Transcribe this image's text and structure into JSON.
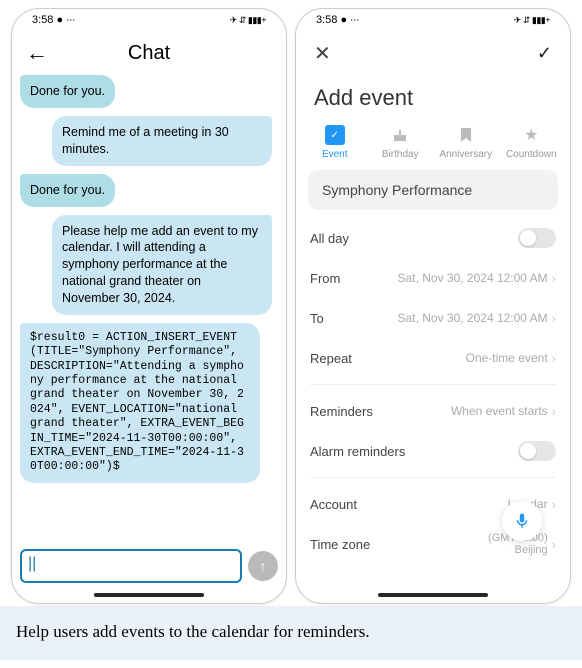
{
  "status": {
    "time": "3:58",
    "dots": "● ∙∙∙",
    "icons": "✈ ⇵ ▮▮▮+"
  },
  "chat": {
    "back": "←",
    "title": "Chat",
    "msgs": {
      "m1": "Done for you.",
      "m2": "Remind me of a meeting in 30 minutes.",
      "m3": "Done for you.",
      "m4": "Please help me add an event to my calendar. I will attending a symphony performance at the national grand theater on November 30, 2024.",
      "m5": "$result0 = ACTION_INSERT_EVENT(TITLE=\"Symphony Performance\", DESCRIPTION=\"Attending a symphony performance at the national grand theater on November 30, 2024\", EVENT_LOCATION=\"national grand theater\", EXTRA_EVENT_BEGIN_TIME=\"2024-11-30T00:00:00\", EXTRA_EVENT_END_TIME=\"2024-11-30T00:00:00\")$"
    },
    "input_value": "|",
    "send": "↑"
  },
  "event": {
    "close": "✕",
    "check": "✓",
    "page_title": "Add event",
    "tabs": {
      "event": "Event",
      "birthday": "Birthday",
      "anniv": "Anniversary",
      "countdown": "Countdown"
    },
    "tab_icons": {
      "event": "✓",
      "birthday": "🎂",
      "anniv": "▮",
      "countdown": "★"
    },
    "name": "Symphony Performance",
    "rows": {
      "allday": "All day",
      "from": "From",
      "from_v": "Sat, Nov 30, 2024 12:00 AM",
      "to": "To",
      "to_v": "Sat, Nov 30, 2024 12:00 AM",
      "repeat": "Repeat",
      "repeat_v": "One-time event",
      "reminders": "Reminders",
      "reminders_v": "When event starts",
      "alarm": "Alarm reminders",
      "account": "Account",
      "account_v": "Loc      dar",
      "tz": "Time zone",
      "tz_v1": "(GMT+8:00)",
      "tz_v2": "Beijing"
    }
  },
  "caption": "Help users add events to the calendar for reminders."
}
